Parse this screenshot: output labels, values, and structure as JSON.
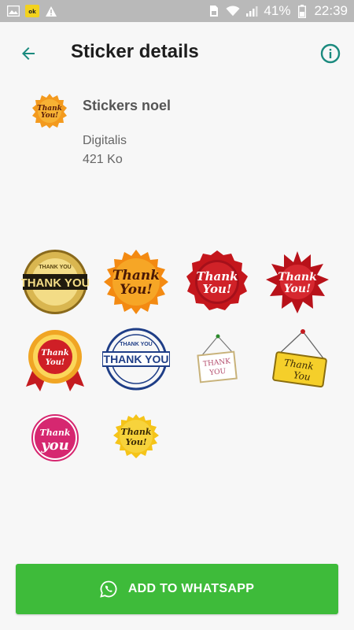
{
  "status_bar": {
    "battery": "41%",
    "time": "22:39"
  },
  "toolbar": {
    "title": "Sticker details"
  },
  "pack": {
    "name": "Stickers noel",
    "publisher": "Digitalis",
    "size": "421 Ko"
  },
  "stickers": [
    {
      "line1": "THANK YOU",
      "line2": "THANK YOU",
      "style": "gold-seal"
    },
    {
      "line1": "Thank",
      "line2": "You!",
      "style": "orange-burst"
    },
    {
      "line1": "Thank",
      "line2": "You!",
      "style": "red-rosette"
    },
    {
      "line1": "Thank",
      "line2": "You!",
      "style": "red-star"
    },
    {
      "line1": "Thank",
      "line2": "You!",
      "style": "ribbon-medal"
    },
    {
      "line1": "THANK YOU",
      "line2": "THANK YOU",
      "style": "blue-stamp"
    },
    {
      "line1": "THANK",
      "line2": "YOU",
      "style": "hanging-sign-white"
    },
    {
      "line1": "Thank",
      "line2": "You",
      "style": "hanging-sign-yellow"
    },
    {
      "line1": "Thank",
      "line2": "you",
      "style": "pink-circle"
    },
    {
      "line1": "Thank",
      "line2": "You!",
      "style": "yellow-burst"
    }
  ],
  "add_button": {
    "label": "ADD TO WHATSAPP"
  },
  "colors": {
    "accent": "#1a8a7e",
    "button": "#3ebb3a"
  }
}
